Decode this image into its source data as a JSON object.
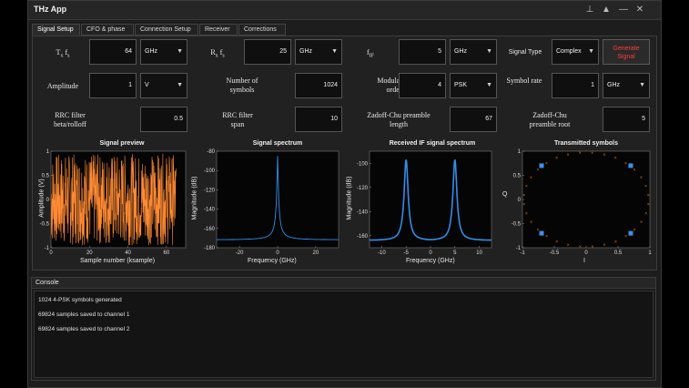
{
  "window": {
    "title": "THz App"
  },
  "titlebar_icons": [
    "pin-icon",
    "collapse-icon",
    "minimize-icon",
    "close-icon"
  ],
  "tabs": [
    {
      "label": "Signal Setup",
      "active": true
    },
    {
      "label": "CFO & phase"
    },
    {
      "label": "Connection Setup"
    },
    {
      "label": "Receiver"
    },
    {
      "label": "Corrections"
    }
  ],
  "params": {
    "tx_fs": {
      "label_main": "T",
      "label_sub": "x",
      "label_rest": " f",
      "label_sub2": "s",
      "value": "64",
      "unit": "GHz"
    },
    "rx_fs": {
      "label_main": "R",
      "label_sub": "x",
      "label_rest": " f",
      "label_sub2": "s",
      "value": "25",
      "unit": "GHz"
    },
    "f_if": {
      "label_main": "f",
      "label_sub": "IF",
      "value": "5",
      "unit": "GHz"
    },
    "signal_type": {
      "label": "Signal Type",
      "value": "Complex"
    },
    "amplitude": {
      "label": "Amplitude",
      "value": "1",
      "unit": "V"
    },
    "num_symbols": {
      "label": "Number of symbols",
      "value": "1024"
    },
    "mod_order": {
      "label": "Modulation order",
      "value": "4",
      "type": "PSK"
    },
    "symbol_rate": {
      "label": "Symbol rate",
      "value": "1",
      "unit": "GHz"
    },
    "rrc_beta": {
      "label": "RRC filter beta/rolloff",
      "value": "0.5"
    },
    "rrc_span": {
      "label": "RRC filter span",
      "value": "10"
    },
    "zc_len": {
      "label": "Zadoff-Chu preamble length",
      "value": "67"
    },
    "zc_root": {
      "label": "Zadoff-Chu preamble root",
      "value": "5"
    },
    "generate_label": "Generate Signal"
  },
  "plots": {
    "preview": {
      "title": "Signal preview",
      "xlabel": "Sample number (ksample)",
      "ylabel": "Amplitude (V)"
    },
    "spectrum": {
      "title": "Signal spectrum",
      "xlabel": "Frequency (GHz)",
      "ylabel": "Magnitude (dB)"
    },
    "if_spectrum": {
      "title": "Received IF signal spectrum",
      "xlabel": "Frequency (GHz)",
      "ylabel": "Magnitude (dB)"
    },
    "symbols": {
      "title": "Transmitted symbols",
      "xlabel": "I",
      "ylabel": "Q"
    }
  },
  "chart_data": [
    {
      "type": "line",
      "title": "Signal preview",
      "xlabel": "Sample number (ksample)",
      "ylabel": "Amplitude (V)",
      "xlim": [
        0,
        70
      ],
      "ylim": [
        -1,
        1
      ],
      "xticks": [
        "0",
        "20",
        "40",
        "60"
      ],
      "yticks": [
        "-1",
        "-0.5",
        "0",
        "0.5",
        "1"
      ],
      "color": "#ff8a33"
    },
    {
      "type": "line",
      "title": "Signal spectrum",
      "xlabel": "Frequency (GHz)",
      "ylabel": "Magnitude (dB)",
      "xlim": [
        -32,
        32
      ],
      "ylim": [
        -180,
        -80
      ],
      "xticks": [
        "-20",
        "0",
        "20"
      ],
      "yticks": [
        "-80",
        "-100",
        "-120",
        "-140",
        "-160",
        "-180"
      ],
      "peak_x": 0,
      "peak_y": -85,
      "floor_y": -172,
      "color": "#2f8fe8"
    },
    {
      "type": "line",
      "title": "Received IF signal spectrum",
      "xlabel": "Frequency (GHz)",
      "ylabel": "Magnitude (dB)",
      "xlim": [
        -12.5,
        12.5
      ],
      "ylim": [
        -170,
        -90
      ],
      "xticks": [
        "-10",
        "-5",
        "0",
        "5",
        "10"
      ],
      "yticks": [
        "-100",
        "-120",
        "-140",
        "-160"
      ],
      "peaks": [
        {
          "x": -5,
          "y": -97
        },
        {
          "x": 5,
          "y": -97
        }
      ],
      "floor_y": -164,
      "color": "#2f8fe8"
    },
    {
      "type": "scatter",
      "title": "Transmitted symbols",
      "xlabel": "I",
      "ylabel": "Q",
      "xlim": [
        -1,
        1
      ],
      "ylim": [
        -1,
        1
      ],
      "xticks": [
        "-1",
        "-0.5",
        "0",
        "0.5",
        "1"
      ],
      "yticks": [
        "-1",
        "-0.5",
        "0",
        "0.5",
        "1"
      ],
      "symbols": [
        [
          -0.7,
          0.7
        ],
        [
          0.7,
          0.7
        ],
        [
          -0.7,
          -0.7
        ],
        [
          0.7,
          -0.7
        ]
      ],
      "symbol_color": "#3d8fe8",
      "preamble_color": "#e07a2e"
    }
  ],
  "console": {
    "title": "Console",
    "lines": [
      "1024 4-PSK symbols generated",
      "69824 samples saved to channel 1",
      "69824 samples saved to channel 2"
    ]
  }
}
